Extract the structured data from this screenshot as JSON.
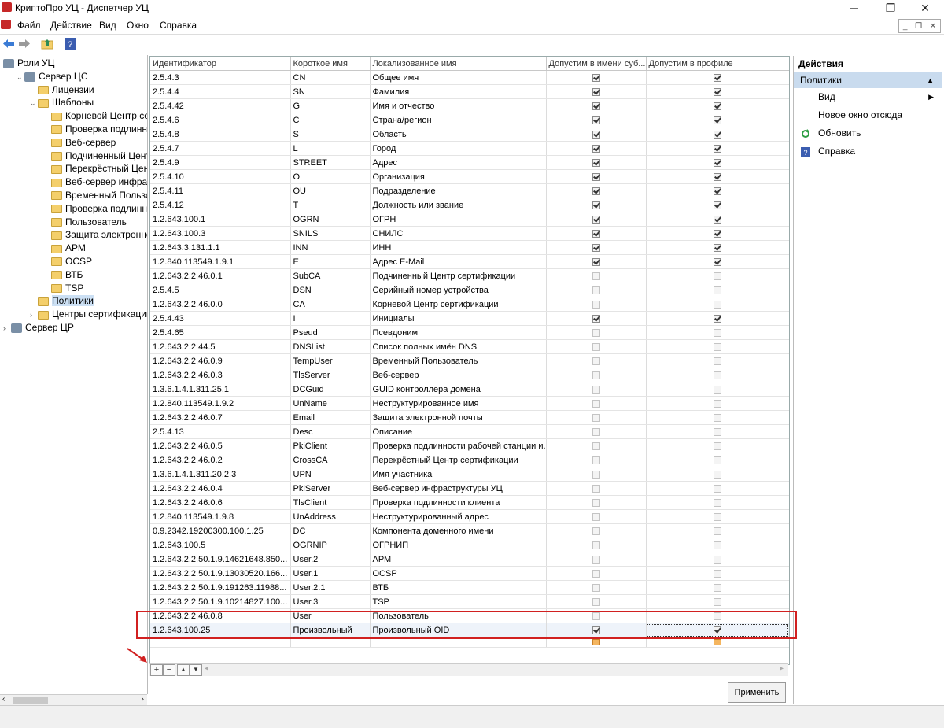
{
  "window": {
    "title": "КриптоПро УЦ - Диспетчер УЦ"
  },
  "menu": [
    "Файл",
    "Действие",
    "Вид",
    "Окно",
    "Справка"
  ],
  "tree": [
    {
      "label": "Роли УЦ",
      "icon": "roles-icon",
      "indent": 0
    },
    {
      "label": "Сервер ЦС",
      "icon": "server-icon",
      "indent": 1,
      "expanded": true
    },
    {
      "label": "Лицензии",
      "icon": "folder-icon",
      "indent": 2
    },
    {
      "label": "Шаблоны",
      "icon": "folder-icon",
      "indent": 2,
      "expanded": true
    },
    {
      "label": "Корневой Центр серт",
      "icon": "folder-icon",
      "indent": 3
    },
    {
      "label": "Проверка подлинност",
      "icon": "folder-icon",
      "indent": 3
    },
    {
      "label": "Веб-сервер",
      "icon": "folder-icon",
      "indent": 3
    },
    {
      "label": "Подчиненный Центр",
      "icon": "folder-icon",
      "indent": 3
    },
    {
      "label": "Перекрёстный Центр",
      "icon": "folder-icon",
      "indent": 3
    },
    {
      "label": "Веб-сервер инфраст",
      "icon": "folder-icon",
      "indent": 3
    },
    {
      "label": "Временный Пользов",
      "icon": "folder-icon",
      "indent": 3
    },
    {
      "label": "Проверка подлиннос",
      "icon": "folder-icon",
      "indent": 3
    },
    {
      "label": "Пользователь",
      "icon": "folder-icon",
      "indent": 3
    },
    {
      "label": "Защита электронной",
      "icon": "folder-icon",
      "indent": 3
    },
    {
      "label": "АРМ",
      "icon": "folder-icon",
      "indent": 3
    },
    {
      "label": "OCSP",
      "icon": "folder-icon",
      "indent": 3
    },
    {
      "label": "ВТБ",
      "icon": "folder-icon",
      "indent": 3
    },
    {
      "label": "TSP",
      "icon": "folder-icon",
      "indent": 3
    },
    {
      "label": "Политики",
      "icon": "folder-icon",
      "indent": 2,
      "selected": true
    },
    {
      "label": "Центры сертификации",
      "icon": "folder-icon",
      "indent": 2,
      "collapsed": true
    },
    {
      "label": "Сервер ЦР",
      "icon": "server-icon",
      "indent": 0,
      "collapsed": true
    }
  ],
  "grid": {
    "columns": [
      "Идентификатор",
      "Короткое имя",
      "Локализованное имя",
      "Допустим в имени суб...",
      "Допустим в профиле"
    ],
    "rows": [
      [
        "2.5.4.3",
        "CN",
        "Общее имя",
        true,
        true
      ],
      [
        "2.5.4.4",
        "SN",
        "Фамилия",
        true,
        true
      ],
      [
        "2.5.4.42",
        "G",
        "Имя и отчество",
        true,
        true
      ],
      [
        "2.5.4.6",
        "C",
        "Страна/регион",
        true,
        true
      ],
      [
        "2.5.4.8",
        "S",
        "Область",
        true,
        true
      ],
      [
        "2.5.4.7",
        "L",
        "Город",
        true,
        true
      ],
      [
        "2.5.4.9",
        "STREET",
        "Адрес",
        true,
        true
      ],
      [
        "2.5.4.10",
        "O",
        "Организация",
        true,
        true
      ],
      [
        "2.5.4.11",
        "OU",
        "Подразделение",
        true,
        true
      ],
      [
        "2.5.4.12",
        "T",
        "Должность или звание",
        true,
        true
      ],
      [
        "1.2.643.100.1",
        "OGRN",
        "ОГРН",
        true,
        true
      ],
      [
        "1.2.643.100.3",
        "SNILS",
        "СНИЛС",
        true,
        true
      ],
      [
        "1.2.643.3.131.1.1",
        "INN",
        "ИНН",
        true,
        true
      ],
      [
        "1.2.840.113549.1.9.1",
        "E",
        "Адрес E-Mail",
        true,
        true
      ],
      [
        "1.2.643.2.2.46.0.1",
        "SubCA",
        "Подчиненный Центр сертификации",
        false,
        false
      ],
      [
        "2.5.4.5",
        "DSN",
        "Серийный номер устройства",
        false,
        false
      ],
      [
        "1.2.643.2.2.46.0.0",
        "CA",
        "Корневой Центр сертификации",
        false,
        false
      ],
      [
        "2.5.4.43",
        "I",
        "Инициалы",
        true,
        true
      ],
      [
        "2.5.4.65",
        "Pseud",
        "Псевдоним",
        false,
        false
      ],
      [
        "1.2.643.2.2.44.5",
        "DNSList",
        "Список полных имён DNS",
        false,
        false
      ],
      [
        "1.2.643.2.2.46.0.9",
        "TempUser",
        "Временный Пользователь",
        false,
        false
      ],
      [
        "1.2.643.2.2.46.0.3",
        "TlsServer",
        "Веб-сервер",
        false,
        false
      ],
      [
        "1.3.6.1.4.1.311.25.1",
        "DCGuid",
        "GUID контроллера домена",
        false,
        false
      ],
      [
        "1.2.840.113549.1.9.2",
        "UnName",
        "Неструктурированное имя",
        false,
        false
      ],
      [
        "1.2.643.2.2.46.0.7",
        "Email",
        "Защита электронной почты",
        false,
        false
      ],
      [
        "2.5.4.13",
        "Desc",
        "Описание",
        false,
        false
      ],
      [
        "1.2.643.2.2.46.0.5",
        "PkiClient",
        "Проверка подлинности рабочей станции и...",
        false,
        false
      ],
      [
        "1.2.643.2.2.46.0.2",
        "CrossCA",
        "Перекрёстный Центр сертификации",
        false,
        false
      ],
      [
        "1.3.6.1.4.1.311.20.2.3",
        "UPN",
        "Имя участника",
        false,
        false
      ],
      [
        "1.2.643.2.2.46.0.4",
        "PkiServer",
        "Веб-сервер инфраструктуры УЦ",
        false,
        false
      ],
      [
        "1.2.643.2.2.46.0.6",
        "TlsClient",
        "Проверка подлинности клиента",
        false,
        false
      ],
      [
        "1.2.840.113549.1.9.8",
        "UnAddress",
        "Неструктурированный адрес",
        false,
        false
      ],
      [
        "0.9.2342.19200300.100.1.25",
        "DC",
        "Компонента доменного имени",
        false,
        false
      ],
      [
        "1.2.643.100.5",
        "OGRNIP",
        "ОГРНИП",
        false,
        false
      ],
      [
        "1.2.643.2.2.50.1.9.14621648.850...",
        "User.2",
        "АРМ",
        false,
        false
      ],
      [
        "1.2.643.2.2.50.1.9.13030520.166...",
        "User.1",
        "OCSP",
        false,
        false
      ],
      [
        "1.2.643.2.2.50.1.9.191263.11988...",
        "User.2.1",
        "ВТБ",
        false,
        false
      ],
      [
        "1.2.643.2.2.50.1.9.10214827.100...",
        "User.3",
        "TSP",
        false,
        false
      ],
      [
        "1.2.643.2.2.46.0.8",
        "User",
        "Пользователь",
        false,
        false
      ],
      [
        "1.2.643.100.25",
        "Произвольный",
        "Произвольный OID",
        true,
        true
      ]
    ],
    "selected_row": 39
  },
  "grid_toolbar": {
    "add": "+",
    "remove": "−",
    "up": "▲",
    "down": "▼"
  },
  "apply_label": "Применить",
  "actions": {
    "title": "Действия",
    "section": "Политики",
    "items": [
      {
        "label": "Вид",
        "icon": "",
        "submenu": true
      },
      {
        "label": "Новое окно отсюда",
        "icon": ""
      },
      {
        "label": "Обновить",
        "icon": "refresh-icon"
      },
      {
        "label": "Справка",
        "icon": "help-icon"
      }
    ]
  },
  "colors": {
    "selection": "#cce0f4",
    "action_section": "#c9dbee",
    "highlight_box": "#d12020",
    "new_row_checkbox": "#f4b55f"
  }
}
